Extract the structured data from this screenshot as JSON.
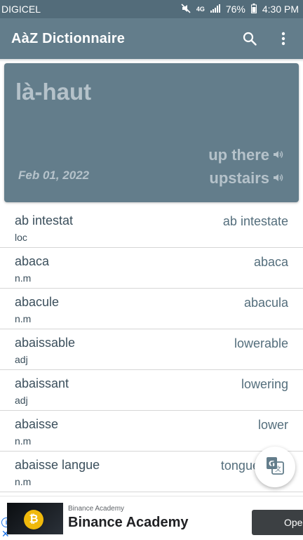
{
  "status_bar": {
    "carrier": "DIGICEL",
    "network": "4G",
    "battery": "76%",
    "time": "4:30 PM",
    "icons": [
      "mute-icon",
      "network-4g-icon",
      "signal-icon",
      "battery-icon"
    ]
  },
  "app_bar": {
    "title": "AàZ Dictionnaire",
    "actions": [
      "search-icon",
      "more-vert-icon"
    ]
  },
  "word_of_day": {
    "word": "là-haut",
    "date": "Feb 01, 2022",
    "translations": [
      "up there",
      "upstairs"
    ],
    "icon": "speaker-icon"
  },
  "entries": [
    {
      "french": "ab intestat",
      "pos": "loc",
      "english": "ab intestate"
    },
    {
      "french": "abaca",
      "pos": "n.m",
      "english": "abaca"
    },
    {
      "french": "abacule",
      "pos": "n.m",
      "english": "abacula"
    },
    {
      "french": "abaissable",
      "pos": "adj",
      "english": "lowerable"
    },
    {
      "french": "abaissant",
      "pos": "adj",
      "english": "lowering"
    },
    {
      "french": "abaisse",
      "pos": "n.m",
      "english": "lower"
    },
    {
      "french": "abaisse langue",
      "pos": "n.m",
      "english": "tongue depr"
    }
  ],
  "fab": {
    "icon": "translate-icon"
  },
  "ad": {
    "sponsor": "Binance Academy",
    "title": "Binance Academy",
    "button": "Open",
    "coin_symbol": "₿"
  },
  "colors": {
    "app_bar": "#637d8b",
    "status_bar": "#536c7a",
    "card_text": "#b5c2ca",
    "row_text": "#3b4f5c"
  }
}
